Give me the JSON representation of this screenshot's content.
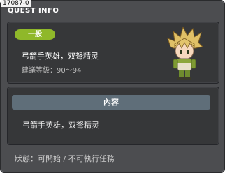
{
  "window": {
    "quest_id": "17087-0",
    "title": "QUEST INFO"
  },
  "quest": {
    "category_badge": "一般",
    "name": "弓箭手英雄，双弩精灵",
    "level_text": "建議等級：90～94",
    "npc_icon": "npc-character-portrait"
  },
  "content": {
    "header": "內容",
    "description": "弓箭手英雄，双弩精灵"
  },
  "footer": {
    "status_text": "狀態：可開始 / 不可執行任務"
  },
  "colors": {
    "window_bg": "#4c4d50",
    "panel_bg": "#363739",
    "badge_green": "#8fb82a",
    "header_bar": "#5f6e79"
  }
}
